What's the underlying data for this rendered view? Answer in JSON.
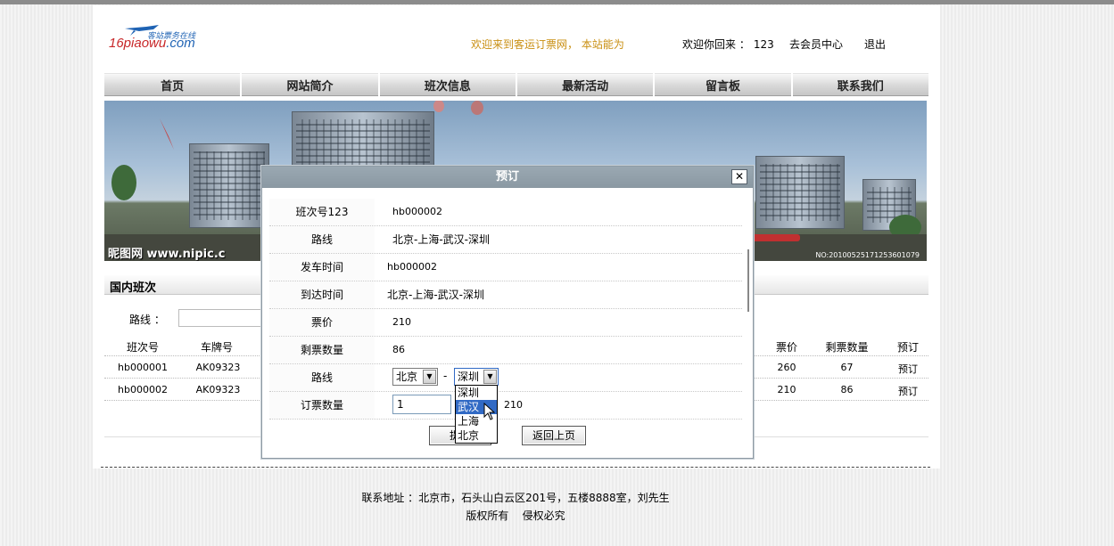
{
  "header": {
    "logo_main": "16piaowu",
    "logo_suffix": ".com",
    "logo_tagline": "客站票务在线",
    "marquee": "欢迎来到客运订票网， 本站能为",
    "welcome_label": "欢迎你回来 ：",
    "username": "123",
    "member_center": "去会员中心",
    "logout": "退出"
  },
  "nav": [
    "首页",
    "网站简介",
    "班次信息",
    "最新活动",
    "留言板",
    "联系我们"
  ],
  "banner": {
    "watermark": "昵图网 www.nipic.c",
    "serial": "NO:20100525171253601079"
  },
  "section": {
    "title": "国内班次",
    "route_label": "路线 ："
  },
  "table": {
    "left_headers": [
      "班次号",
      "车牌号"
    ],
    "right_headers": [
      "票价",
      "剩票数量",
      "预订"
    ],
    "rows": [
      {
        "id": "hb000001",
        "plate": "AK09323",
        "price": "260",
        "remaining": "67",
        "action": "预订"
      },
      {
        "id": "hb000002",
        "plate": "AK09323",
        "price": "210",
        "remaining": "86",
        "action": "预订"
      }
    ]
  },
  "modal": {
    "title": "预订",
    "close": "✕",
    "fields": [
      {
        "label": "班次号123",
        "value": "hb000002"
      },
      {
        "label": "路线",
        "value": "北京-上海-武汉-深圳"
      },
      {
        "label": "发车时间",
        "value": "hb000002"
      },
      {
        "label": "到达时间",
        "value": "北京-上海-武汉-深圳"
      },
      {
        "label": "票价",
        "value": "210"
      },
      {
        "label": "剩票数量",
        "value": "86"
      },
      {
        "label": "路线",
        "value": ""
      },
      {
        "label": "订票数量",
        "value": ""
      }
    ],
    "route_from": "北京",
    "route_sep": "-",
    "route_to": "深圳",
    "dropdown_options": [
      "深圳",
      "武汉",
      "上海",
      "北京"
    ],
    "dropdown_highlight": "武汉",
    "quantity": "1",
    "total": "210",
    "submit": "提交",
    "back": "返回上页"
  },
  "footer": {
    "address": "联系地址 ：北京市，石头山白云区201号，五楼8888室，刘先生",
    "copyright": "版权所有    侵权必究"
  },
  "colors": {
    "marquee": "#c98f12",
    "modal_title_bg": "#8a98a2",
    "dropdown_highlight": "#316ac5"
  }
}
